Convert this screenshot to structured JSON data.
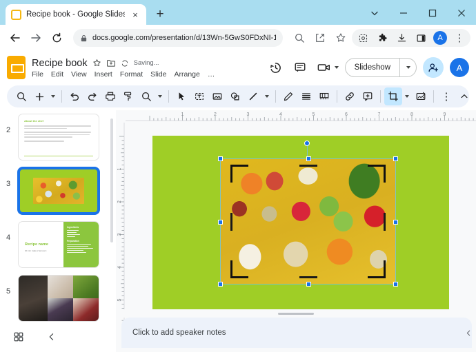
{
  "browser": {
    "tab": {
      "title": "Recipe book - Google Slides",
      "favicon": "slides-favicon",
      "close_label": "×"
    },
    "new_tab_label": "+",
    "window_controls": {
      "tab_search": "⌄",
      "minimize": "–",
      "maximize": "□",
      "close": "✕"
    },
    "nav": {
      "back": "←",
      "forward": "→",
      "reload": "⟳"
    },
    "omnibox": {
      "lock_icon": "lock-icon",
      "url": "docs.google.com/presentation/d/13Wn-5GwS0FDxNI-1…",
      "search_icon": "search-icon",
      "share_icon": "share-icon",
      "bookmark_icon": "star-icon"
    },
    "extensions": {
      "capture": "capture-icon",
      "puzzle": "extensions-icon",
      "download": "download-icon",
      "side_panel": "side-panel-icon",
      "profile_initial": "A",
      "menu": "⋮"
    }
  },
  "app": {
    "logo": "google-slides-logo",
    "doc_title": "Recipe book",
    "star_label": "☆",
    "move_label": "move-to-folder-icon",
    "sync_label": "sync-icon",
    "save_status": "Saving...",
    "menus": [
      {
        "label": "File"
      },
      {
        "label": "Edit"
      },
      {
        "label": "View"
      },
      {
        "label": "Insert"
      },
      {
        "label": "Format"
      },
      {
        "label": "Slide"
      },
      {
        "label": "Arrange"
      },
      {
        "label": "…"
      }
    ],
    "actions": {
      "history_icon": "version-history-icon",
      "comment_icon": "comment-icon",
      "meet_icon": "video-camera-icon",
      "slideshow_label": "Slideshow",
      "share_icon": "add-person-icon",
      "avatar_initial": "A"
    }
  },
  "toolbar": {
    "items": [
      {
        "name": "search-icon",
        "type": "icon"
      },
      {
        "name": "new-slide-icon",
        "type": "icon",
        "caret": true
      },
      {
        "name": "separator",
        "type": "sep"
      },
      {
        "name": "undo-icon",
        "type": "icon"
      },
      {
        "name": "redo-icon",
        "type": "icon"
      },
      {
        "name": "print-icon",
        "type": "icon"
      },
      {
        "name": "paint-format-icon",
        "type": "icon"
      },
      {
        "name": "zoom-icon",
        "type": "icon",
        "caret": true
      },
      {
        "name": "separator",
        "type": "sep"
      },
      {
        "name": "select-cursor-icon",
        "type": "icon"
      },
      {
        "name": "text-box-icon",
        "type": "icon"
      },
      {
        "name": "insert-image-icon",
        "type": "icon"
      },
      {
        "name": "shape-icon",
        "type": "icon"
      },
      {
        "name": "line-icon",
        "type": "icon",
        "caret": true
      },
      {
        "name": "separator",
        "type": "sep"
      },
      {
        "name": "pen-icon",
        "type": "icon"
      },
      {
        "name": "text-align-icon",
        "type": "icon"
      },
      {
        "name": "transition-icon",
        "type": "icon"
      },
      {
        "name": "separator",
        "type": "sep"
      },
      {
        "name": "insert-link-icon",
        "type": "icon"
      },
      {
        "name": "add-comment-icon",
        "type": "icon"
      },
      {
        "name": "separator",
        "type": "sep"
      },
      {
        "name": "crop-image-icon",
        "type": "icon",
        "caret": true,
        "active": true
      },
      {
        "name": "mask-image-icon",
        "type": "icon"
      },
      {
        "name": "separator",
        "type": "sep"
      },
      {
        "name": "more-options-icon",
        "type": "icon"
      }
    ],
    "collapse_icon": "chevron-up-icon",
    "active_tool": "crop-image-icon",
    "accent_color": "#c2e7ff"
  },
  "filmstrip": {
    "slides": [
      {
        "number": "2",
        "selected": false,
        "kind": "text",
        "heading": "About the chef",
        "body_lines": [
          2,
          3,
          1
        ]
      },
      {
        "number": "3",
        "selected": true,
        "kind": "photo-on-green",
        "background": "#9fce26"
      },
      {
        "number": "4",
        "selected": false,
        "kind": "recipe",
        "title": "Recipe name",
        "subtitle": "20 min make | Serves 4",
        "panel_headings": [
          "Ingredients",
          "Preparation"
        ]
      },
      {
        "number": "5",
        "selected": false,
        "kind": "photo-grid"
      }
    ],
    "footer": {
      "grid_view_icon": "grid-view-icon",
      "collapse_icon": "chevron-left-icon"
    }
  },
  "editor": {
    "ruler_h_labels": [
      "1",
      "2",
      "3",
      "4",
      "5",
      "6",
      "7",
      "8",
      "9"
    ],
    "ruler_v_labels": [
      "1",
      "2",
      "3",
      "4",
      "5"
    ],
    "slide": {
      "background_color": "#9fce26"
    },
    "selected_object": {
      "name": "food-photo",
      "mode": "crop",
      "selection_color": "#1a73e8",
      "crop_bracket_color": "#1a1a1a"
    }
  },
  "notes": {
    "placeholder": "Click to add speaker notes",
    "collapse_icon": "chevron-left-icon",
    "drag_handle": "notes-drag-handle"
  }
}
